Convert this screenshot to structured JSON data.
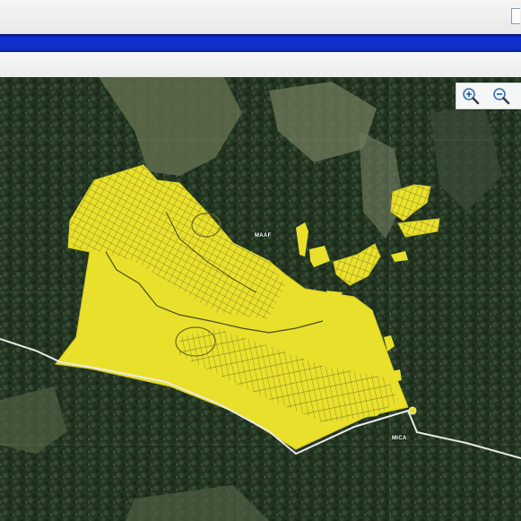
{
  "browser": {
    "icons": [
      "page-icon"
    ]
  },
  "map": {
    "colors": {
      "forest_dark": "#1d2d1f",
      "forest_mid": "#2e4530",
      "meadow": "#6f7d58",
      "development_fill": "#e8e02a",
      "parcel_line": "#5a5a1c",
      "road": "#e6e6e6",
      "stream": "#4a4a2a"
    },
    "labels": {
      "north_area": "MAAF",
      "road_junction": "MICA"
    },
    "zoom": {
      "in_icon": "zoom-in-magnifier-icon",
      "out_icon": "zoom-out-magnifier-icon"
    }
  }
}
